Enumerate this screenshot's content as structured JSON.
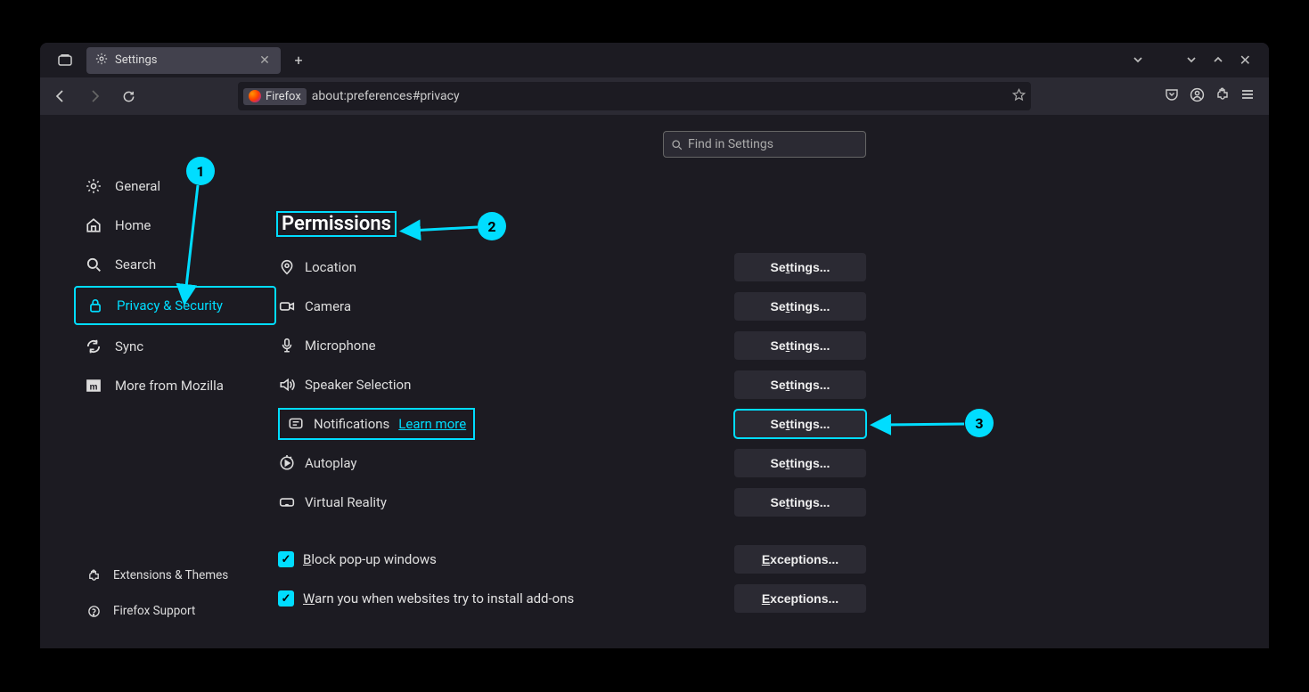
{
  "browser": {
    "tab_title": "Settings",
    "url_badge": "Firefox",
    "url": "about:preferences#privacy",
    "search_placeholder": "Find in Settings"
  },
  "sidebar": {
    "items": [
      {
        "label": "General"
      },
      {
        "label": "Home"
      },
      {
        "label": "Search"
      },
      {
        "label": "Privacy & Security"
      },
      {
        "label": "Sync"
      },
      {
        "label": "More from Mozilla"
      }
    ],
    "bottom": [
      {
        "label": "Extensions & Themes"
      },
      {
        "label": "Firefox Support"
      }
    ]
  },
  "section": {
    "title": "Permissions",
    "rows": [
      {
        "label": "Location",
        "button": "Settings..."
      },
      {
        "label": "Camera",
        "button": "Settings..."
      },
      {
        "label": "Microphone",
        "button": "Settings..."
      },
      {
        "label": "Speaker Selection",
        "button": "Settings..."
      },
      {
        "label": "Notifications",
        "link": "Learn more",
        "button": "Settings..."
      },
      {
        "label": "Autoplay",
        "button": "Settings..."
      },
      {
        "label": "Virtual Reality",
        "button": "Settings..."
      }
    ],
    "checkboxes": [
      {
        "label_pre": "B",
        "label_rest": "lock pop-up windows",
        "button_pre": "E",
        "button_rest": "xceptions..."
      },
      {
        "label_pre": "W",
        "label_rest": "arn you when websites try to install add-ons",
        "button_pre": "E",
        "button_rest": "xceptions..."
      }
    ]
  },
  "annotations": {
    "n1": "1",
    "n2": "2",
    "n3": "3"
  }
}
